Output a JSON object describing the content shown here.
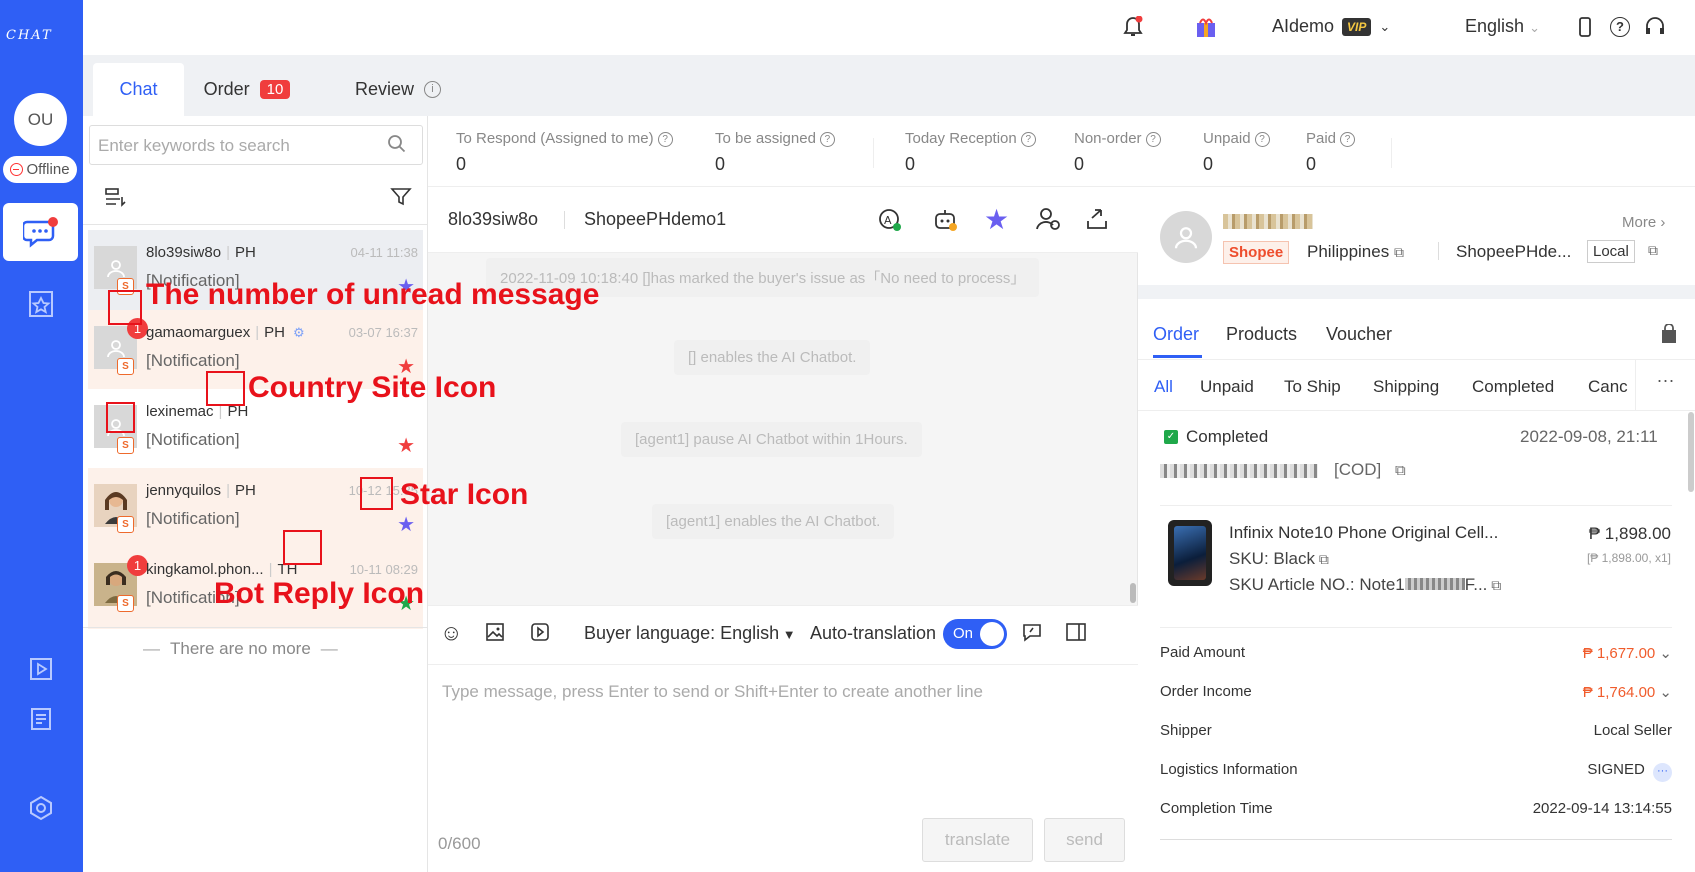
{
  "nav": {
    "logo": "CHAT",
    "avatar": "OU",
    "status": "Offline"
  },
  "topbar": {
    "user": "AIdemo",
    "vip": "VIP",
    "language": "English"
  },
  "tabs": [
    {
      "label": "Chat"
    },
    {
      "label": "Order",
      "badge": "10"
    },
    {
      "label": "Review"
    }
  ],
  "left": {
    "search_placeholder": "Enter keywords to search",
    "conversations": [
      {
        "name": "8lo39siw8o",
        "site": "PH",
        "time": "04-11 11:38",
        "msg": "[Notification]",
        "star_color": "#6a5ff0"
      },
      {
        "name": "gamaomarguex",
        "site": "PH",
        "time": "03-07 16:37",
        "msg": "[Notification]",
        "unread": "1",
        "star_color": "#f03d3d"
      },
      {
        "name": "lexinemac",
        "site": "PH",
        "time": "",
        "msg": "[Notification]",
        "star_color": "#f03d3d"
      },
      {
        "name": "jennyquilos",
        "site": "PH",
        "time": "10-12 15:35",
        "msg": "[Notification]",
        "star_color": "#6a5ff0"
      },
      {
        "name": "kingkamol.phon...",
        "site": "TH",
        "time": "10-11 08:29",
        "msg": "[Notification]",
        "unread": "1",
        "star_color": "#1fa84a"
      }
    ],
    "no_more": "There are no more"
  },
  "annotations": {
    "unread": "The number of unread message",
    "country": "Country Site Icon",
    "star": "Star Icon",
    "bot": "Bot Reply Icon"
  },
  "stats": [
    {
      "label": "To Respond (Assigned to me)",
      "value": "0"
    },
    {
      "label": "To be assigned",
      "value": "0"
    },
    {
      "label": "Today Reception",
      "value": "0"
    },
    {
      "label": "Non-order",
      "value": "0"
    },
    {
      "label": "Unpaid",
      "value": "0"
    },
    {
      "label": "Paid",
      "value": "0"
    }
  ],
  "chat": {
    "buyer": "8lo39siw8o",
    "shop": "ShopeePHdemo1",
    "messages": [
      "2022-11-09 10:18:40 []has marked the buyer's issue as「No need to process」",
      "[] enables the AI Chatbot.",
      "[agent1] pause AI Chatbot within 1Hours.",
      "[agent1] enables the AI Chatbot."
    ],
    "buyer_language_label": "Buyer language:",
    "buyer_language": "English",
    "auto_translation": "Auto-translation",
    "toggle": "On",
    "input_placeholder": "Type message, press Enter to send or Shift+Enter to create another line",
    "counter": "0/600",
    "translate": "translate",
    "send": "send"
  },
  "right": {
    "more": "More",
    "platform": "Shopee",
    "country": "Philippines",
    "shop": "ShopeePHde...",
    "local": "Local",
    "tabs": [
      "Order",
      "Products",
      "Voucher"
    ],
    "subtabs": [
      "All",
      "Unpaid",
      "To Ship",
      "Shipping",
      "Completed",
      "Cance"
    ],
    "order": {
      "status": "Completed",
      "date": "2022-09-08, 21:11",
      "payment": "[COD]",
      "product": "Infinix Note10 Phone Original Cell...",
      "price": "₱ 1,898.00",
      "price_detail": "[₱ 1,898.00, x1]",
      "sku": "SKU: Black",
      "sku_article": "SKU Article NO.: Note1",
      "sku_article_tail": "F..."
    },
    "details": [
      {
        "label": "Paid Amount",
        "value": "₱ 1,677.00"
      },
      {
        "label": "Order Income",
        "value": "₱ 1,764.00"
      },
      {
        "label": "Shipper",
        "value": "Local Seller"
      },
      {
        "label": "Logistics Information",
        "value": "SIGNED"
      },
      {
        "label": "Completion Time",
        "value": "2022-09-14 13:14:55"
      }
    ]
  },
  "colors": {
    "brand": "#2f5ff5",
    "badge": "#f03d3d",
    "annotation": "#e8121b"
  }
}
